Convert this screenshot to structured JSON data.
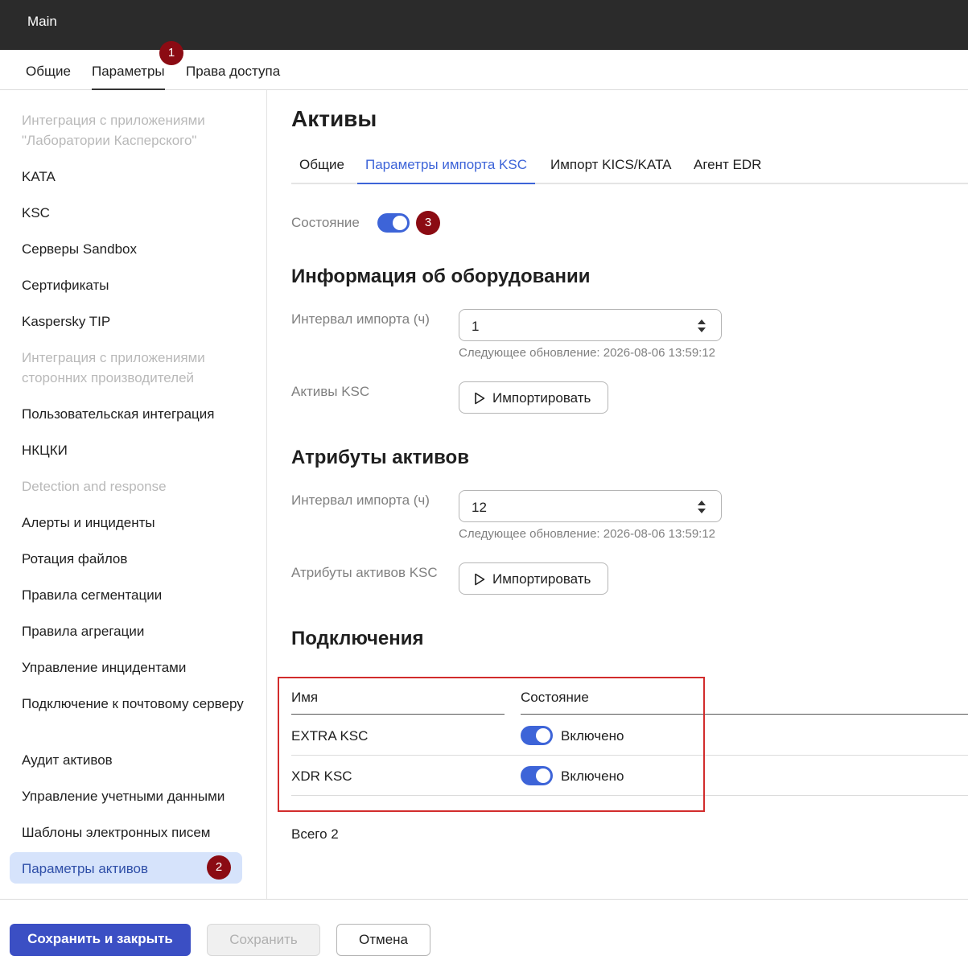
{
  "header": {
    "title": "Main"
  },
  "main_tabs": [
    {
      "label": "Общие"
    },
    {
      "label": "Параметры",
      "active": true
    },
    {
      "label": "Права доступа"
    }
  ],
  "badges": [
    "1",
    "2",
    "3"
  ],
  "sidebar": {
    "items": [
      {
        "label": "Интеграция с приложениями \"Лаборатории Касперского\"",
        "group": true
      },
      {
        "label": "KATA"
      },
      {
        "label": "KSC"
      },
      {
        "label": "Серверы Sandbox"
      },
      {
        "label": "Сертификаты"
      },
      {
        "label": "Kaspersky TIP"
      },
      {
        "label": "Интеграция с приложениями сторонних производителей",
        "group": true
      },
      {
        "label": "Пользовательская интеграция"
      },
      {
        "label": "НКЦКИ"
      },
      {
        "label": "Detection and response",
        "group": true
      },
      {
        "label": "Алерты и инциденты"
      },
      {
        "label": "Ротация файлов"
      },
      {
        "label": "Правила сегментации"
      },
      {
        "label": "Правила агрегации"
      },
      {
        "label": "Управление инцидентами"
      },
      {
        "label": "Подключение к почтовому серверу"
      },
      {
        "label": "Аудит активов"
      },
      {
        "label": "Управление учетными данными"
      },
      {
        "label": "Шаблоны электронных писем"
      },
      {
        "label": "Параметры активов",
        "active": true
      }
    ]
  },
  "content": {
    "title": "Активы",
    "subtabs": [
      {
        "label": "Общие"
      },
      {
        "label": "Параметры импорта KSC",
        "active": true
      },
      {
        "label": "Импорт KICS/KATA"
      },
      {
        "label": "Агент EDR"
      }
    ],
    "state_label": "Состояние",
    "hardware": {
      "title": "Информация об оборудовании",
      "interval_label": "Интервал импорта (ч)",
      "interval_value": "1",
      "next_update": "Следующее обновление: 2026-08-06 13:59:12",
      "assets_label": "Активы KSC",
      "import_button": "Импортировать"
    },
    "attributes": {
      "title": "Атрибуты активов",
      "interval_label": "Интервал импорта (ч)",
      "interval_value": "12",
      "next_update": "Следующее обновление: 2026-08-06 13:59:12",
      "assets_label": "Атрибуты активов KSC",
      "import_button": "Импортировать"
    },
    "connections": {
      "title": "Подключения",
      "columns": [
        "Имя",
        "Состояние"
      ],
      "rows": [
        {
          "name": "EXTRA KSC",
          "status": "Включено"
        },
        {
          "name": "XDR KSC",
          "status": "Включено"
        }
      ],
      "total": "Всего 2"
    }
  },
  "footer": {
    "save_close": "Сохранить и закрыть",
    "save": "Сохранить",
    "cancel": "Отмена"
  },
  "colors": {
    "accent": "#3d64d8",
    "badge": "#8b0b13",
    "topbar": "#2b2b2b",
    "highlight_box": "#d22c2c"
  }
}
